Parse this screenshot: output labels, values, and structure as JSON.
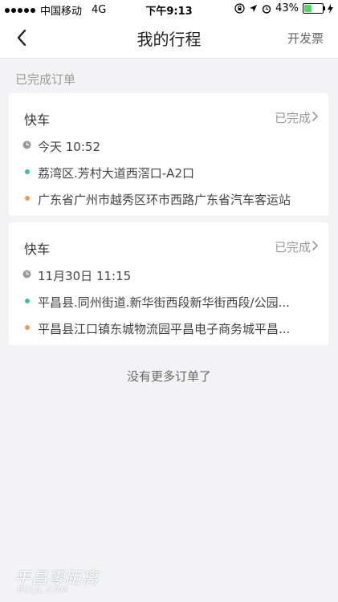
{
  "status_bar": {
    "carrier": "中国移动",
    "network": "4G",
    "time": "下午9:13",
    "battery": "43%"
  },
  "nav": {
    "title": "我的行程",
    "invoice": "开发票"
  },
  "section": {
    "title": "已完成订单"
  },
  "orders": [
    {
      "type": "快车",
      "status": "已完成",
      "time": "今天 10:52",
      "from": "荔湾区.芳村大道西滘口-A2口",
      "to": "广东省广州市越秀区环市西路广东省汽车客运站"
    },
    {
      "type": "快车",
      "status": "已完成",
      "time": "11月30日 11:15",
      "from": "平昌县.同州街道.新华街西段新华街西段/公园...",
      "to": "平昌县江口镇东城物流园平昌电子商务城平昌..."
    }
  ],
  "footer": {
    "no_more": "没有更多订单了"
  },
  "watermark": {
    "text": "平昌零距离",
    "sub": "PCLJL.COM"
  },
  "colors": {
    "green_dot": "#3dbf8f",
    "orange_dot": "#f29a4b",
    "battery": "#4cd964"
  },
  "icons": [
    "signal-dots-icon",
    "lock-rotation-icon",
    "location-arrow-icon",
    "alarm-icon",
    "battery-icon",
    "charging-icon",
    "back-chevron-icon",
    "chevron-right-icon",
    "clock-icon"
  ]
}
